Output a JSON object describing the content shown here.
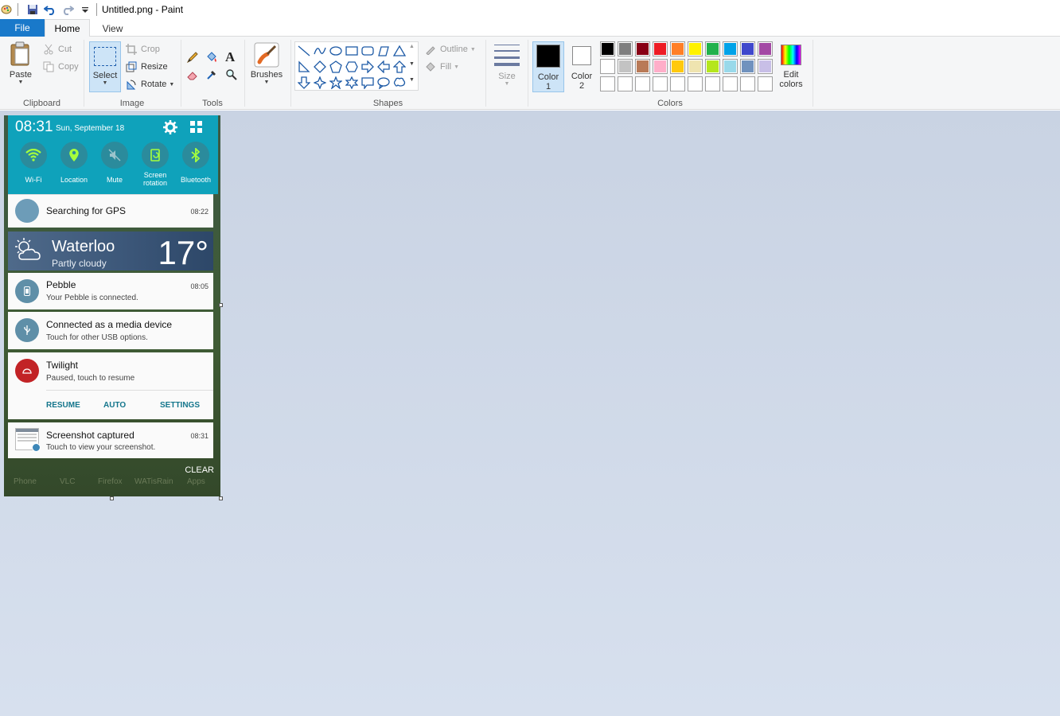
{
  "window": {
    "title": "Untitled.png - Paint"
  },
  "tabs": {
    "file": "File",
    "home": "Home",
    "view": "View"
  },
  "clipboard": {
    "paste": "Paste",
    "cut": "Cut",
    "copy": "Copy",
    "label": "Clipboard"
  },
  "image": {
    "select": "Select",
    "crop": "Crop",
    "resize": "Resize",
    "rotate": "Rotate",
    "label": "Image"
  },
  "tools": {
    "label": "Tools"
  },
  "brushes": {
    "label": "Brushes"
  },
  "shapes": {
    "outline": "Outline",
    "fill": "Fill",
    "label": "Shapes"
  },
  "size": {
    "label": "Size"
  },
  "colors": {
    "color1_line1": "Color",
    "color1_line2": "1",
    "color2_line1": "Color",
    "color2_line2": "2",
    "edit_line1": "Edit",
    "edit_line2": "colors",
    "label": "Colors",
    "color1": "#000000",
    "color2": "#ffffff",
    "palette_row1": [
      "#000000",
      "#7f7f7f",
      "#880015",
      "#ed1c24",
      "#ff7f27",
      "#fff200",
      "#22b14c",
      "#00a2e8",
      "#3f48cc",
      "#a349a4"
    ],
    "palette_row2": [
      "#ffffff",
      "#c3c3c3",
      "#b97a57",
      "#ffaec9",
      "#ffc90e",
      "#efe4b0",
      "#b5e61d",
      "#99d9ea",
      "#7092be",
      "#c8bfe7"
    ]
  },
  "phone": {
    "time": "08:31",
    "date": "Sun, September 18",
    "quick_settings": [
      {
        "label": "Wi-Fi"
      },
      {
        "label": "Location"
      },
      {
        "label": "Mute"
      },
      {
        "label": "Screen\nrotation"
      },
      {
        "label": "Bluetooth"
      }
    ],
    "gps": {
      "title": "Searching for GPS",
      "time": "08:22"
    },
    "weather": {
      "city": "Waterloo",
      "condition": "Partly cloudy",
      "temp": "17°"
    },
    "pebble": {
      "title": "Pebble",
      "subtitle": "Your Pebble is connected.",
      "time": "08:05"
    },
    "usb": {
      "title": "Connected as a media device",
      "subtitle": "Touch for other USB options."
    },
    "twilight": {
      "title": "Twilight",
      "subtitle": "Paused, touch to resume",
      "actions": [
        "RESUME",
        "AUTO",
        "SETTINGS"
      ]
    },
    "screenshot": {
      "title": "Screenshot captured",
      "subtitle": "Touch to view your screenshot.",
      "time": "08:31"
    },
    "clear": "CLEAR",
    "dock": [
      "Phone",
      "VLC",
      "Firefox",
      "WATisRain",
      "Apps"
    ]
  }
}
